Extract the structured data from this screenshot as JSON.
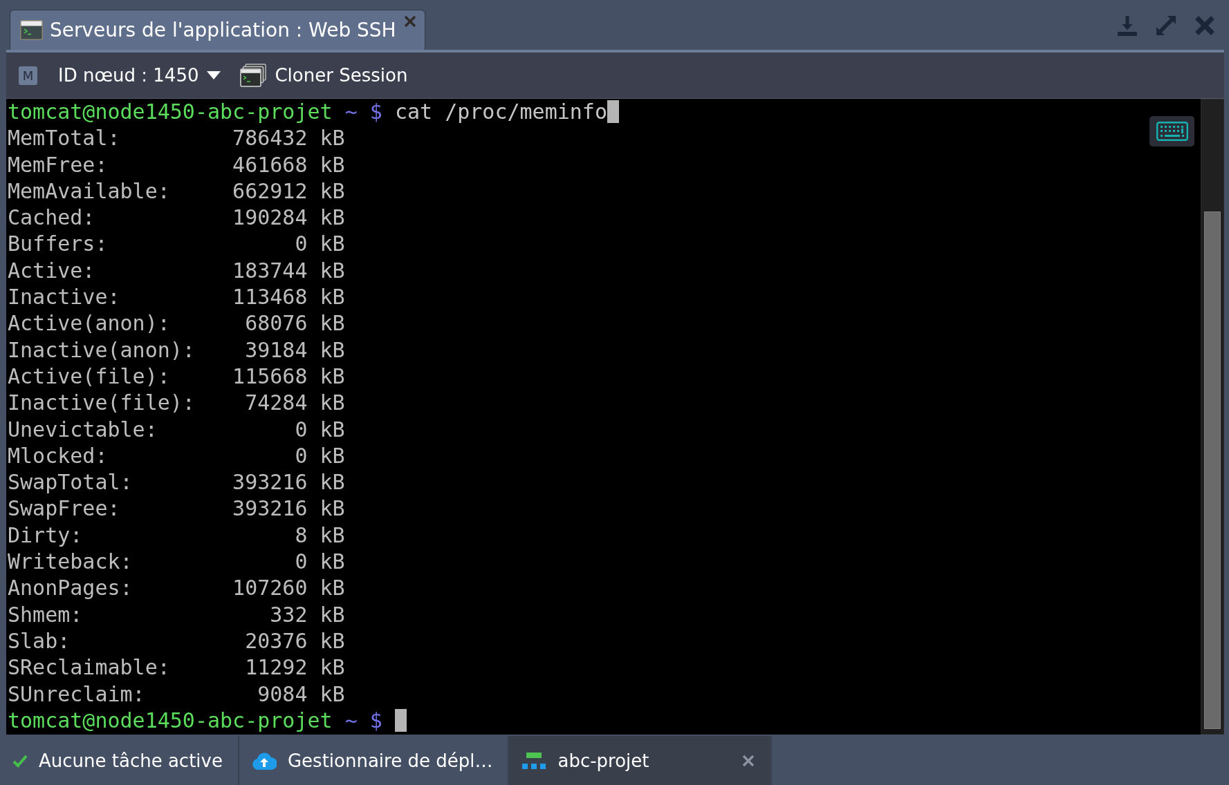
{
  "window": {
    "tab": {
      "title": "Serveurs de l'application : Web SSH",
      "selected": true
    }
  },
  "toolbar": {
    "badge": "M",
    "node_selector": "ID nœud : 1450",
    "clone_button": "Cloner Session"
  },
  "terminal": {
    "lines": [
      {
        "kind": "prompt",
        "user_host": "tomcat@node1450-abc-projet",
        "prompt_sign": "~ $",
        "command": "cat /proc/meminfo",
        "cursor": true
      },
      {
        "kind": "output",
        "key": "MemTotal:",
        "value": "786432 kB"
      },
      {
        "kind": "output",
        "key": "MemFree:",
        "value": "461668 kB"
      },
      {
        "kind": "output",
        "key": "MemAvailable:",
        "value": "662912 kB"
      },
      {
        "kind": "output",
        "key": "Cached:",
        "value": "190284 kB"
      },
      {
        "kind": "output",
        "key": "Buffers:",
        "value": "0 kB"
      },
      {
        "kind": "output",
        "key": "Active:",
        "value": "183744 kB"
      },
      {
        "kind": "output",
        "key": "Inactive:",
        "value": "113468 kB"
      },
      {
        "kind": "output",
        "key": "Active(anon):",
        "value": "68076 kB"
      },
      {
        "kind": "output",
        "key": "Inactive(anon):",
        "value": "39184 kB"
      },
      {
        "kind": "output",
        "key": "Active(file):",
        "value": "115668 kB"
      },
      {
        "kind": "output",
        "key": "Inactive(file):",
        "value": "74284 kB"
      },
      {
        "kind": "output",
        "key": "Unevictable:",
        "value": "0 kB"
      },
      {
        "kind": "output",
        "key": "Mlocked:",
        "value": "0 kB"
      },
      {
        "kind": "output",
        "key": "SwapTotal:",
        "value": "393216 kB"
      },
      {
        "kind": "output",
        "key": "SwapFree:",
        "value": "393216 kB"
      },
      {
        "kind": "output",
        "key": "Dirty:",
        "value": "8 kB"
      },
      {
        "kind": "output",
        "key": "Writeback:",
        "value": "0 kB"
      },
      {
        "kind": "output",
        "key": "AnonPages:",
        "value": "107260 kB"
      },
      {
        "kind": "output",
        "key": "Shmem:",
        "value": "332 kB"
      },
      {
        "kind": "output",
        "key": "Slab:",
        "value": "20376 kB"
      },
      {
        "kind": "output",
        "key": "SReclaimable:",
        "value": "11292 kB"
      },
      {
        "kind": "output",
        "key": "SUnreclaim:",
        "value": "9084 kB"
      },
      {
        "kind": "prompt",
        "user_host": "tomcat@node1450-abc-projet",
        "prompt_sign": "~ $",
        "cursor": true
      }
    ]
  },
  "taskbar": {
    "items": [
      {
        "kind": "status",
        "label": "Aucune tâche active",
        "selected": false
      },
      {
        "kind": "app",
        "label": "Gestionnaire de dépl…",
        "selected": false
      },
      {
        "kind": "project",
        "label": "abc-projet",
        "selected": true,
        "closable": true
      }
    ]
  }
}
